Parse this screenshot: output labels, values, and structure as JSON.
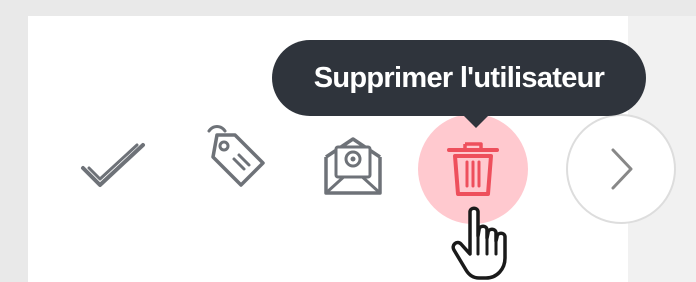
{
  "tooltip": {
    "text": "Supprimer l'utilisateur"
  },
  "actions": [
    {
      "icon": "check-icon",
      "interactable": true
    },
    {
      "icon": "tag-icon",
      "interactable": true
    },
    {
      "icon": "mail-icon",
      "interactable": true
    },
    {
      "icon": "trash-icon",
      "interactable": true,
      "state": "hover"
    },
    {
      "icon": "chevron-right-icon",
      "interactable": true
    }
  ],
  "colors": {
    "tooltip_bg": "#2f343c",
    "tooltip_text": "#ffffff",
    "icon_stroke": "#6e7278",
    "delete_hover_bg": "#ffc9cf",
    "delete_icon": "#ee4f5c",
    "panel_bg": "#ffffff",
    "outer_bg": "#e9e9e9"
  }
}
